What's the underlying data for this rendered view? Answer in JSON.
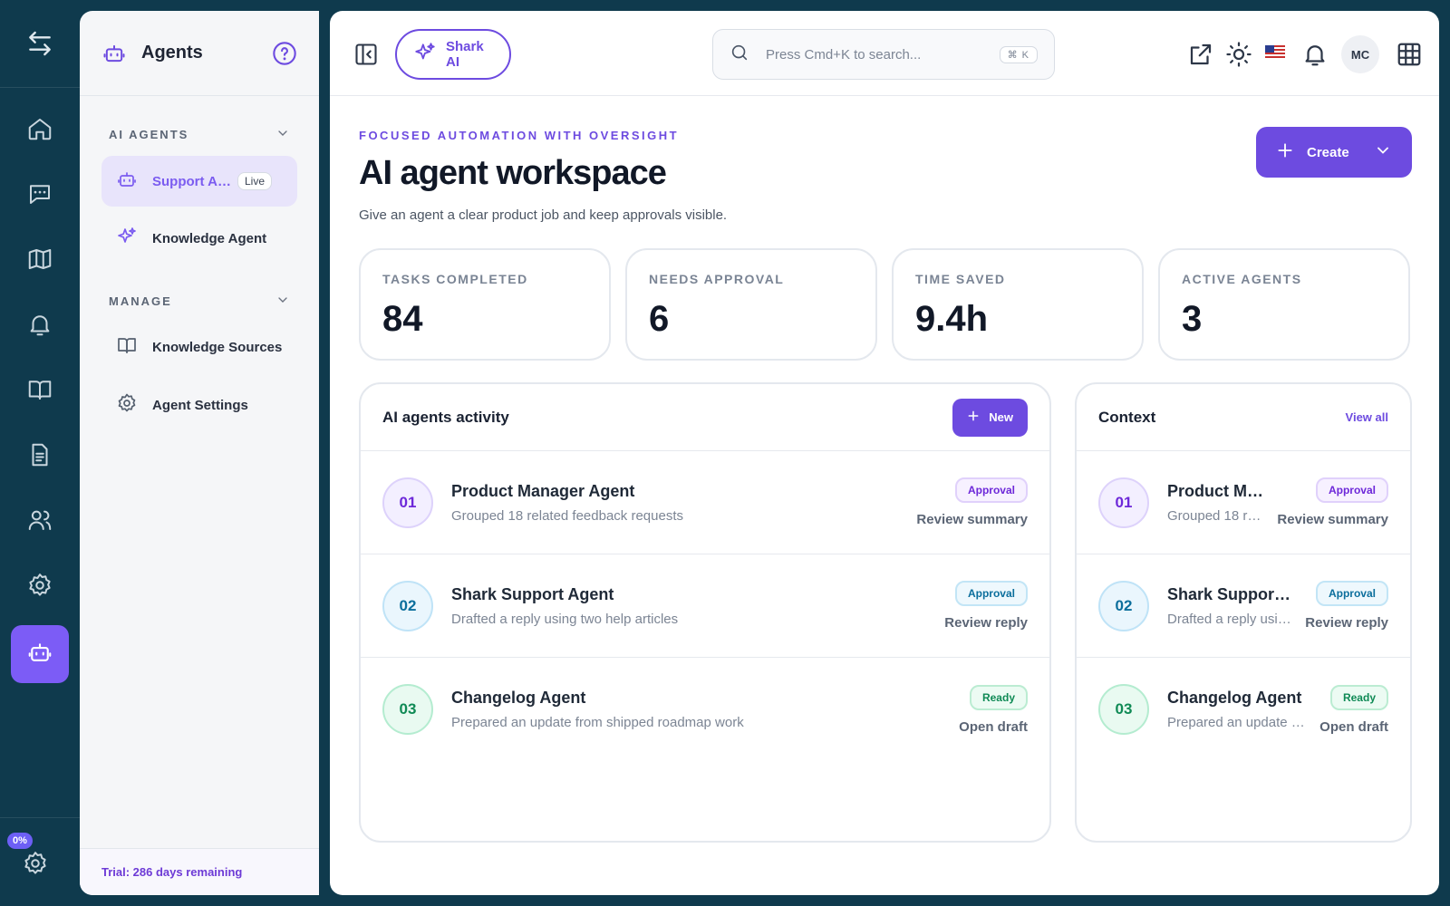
{
  "rail": {
    "items": [
      "swap-arrows-icon",
      "home-icon",
      "chat-icon",
      "map-icon",
      "bell-icon",
      "book-icon",
      "document-icon",
      "users-icon",
      "gear-icon",
      "robot-icon"
    ],
    "badge": "0%"
  },
  "sidebar": {
    "title": "Agents",
    "section_ai": "AI AGENTS",
    "section_manage": "MANAGE",
    "items": [
      {
        "label": "Support Agent",
        "pill": "Live"
      },
      {
        "label": "Knowledge Agent"
      },
      {
        "label": "Knowledge Sources"
      },
      {
        "label": "Agent Settings"
      }
    ],
    "footer": "Trial: 286 days remaining"
  },
  "topbar": {
    "shark_label": "Shark AI",
    "search_placeholder": "Press Cmd+K to search...",
    "shortcut": "⌘ K",
    "avatar": "MC"
  },
  "header": {
    "eyebrow": "FOCUSED AUTOMATION WITH OVERSIGHT",
    "title": "AI agent workspace",
    "subtitle": "Give an agent a clear product job and keep approvals visible.",
    "create_label": "Create"
  },
  "stats": [
    {
      "label": "TASKS COMPLETED",
      "value": "84"
    },
    {
      "label": "NEEDS APPROVAL",
      "value": "6"
    },
    {
      "label": "TIME SAVED",
      "value": "9.4h"
    },
    {
      "label": "ACTIVE AGENTS",
      "value": "3"
    }
  ],
  "activity": {
    "title": "AI agents activity",
    "new_label": "New",
    "rows": [
      {
        "num": "01",
        "title": "Product Manager Agent",
        "desc": "Grouped 18 related feedback requests",
        "pill": "Approval",
        "action": "Review summary"
      },
      {
        "num": "02",
        "title": "Shark Support Agent",
        "desc": "Drafted a reply using two help articles",
        "pill": "Approval",
        "action": "Review reply"
      },
      {
        "num": "03",
        "title": "Changelog Agent",
        "desc": "Prepared an update from shipped roadmap work",
        "pill": "Ready",
        "action": "Open draft"
      }
    ]
  },
  "context": {
    "title": "Context",
    "view_all": "View all"
  },
  "colors": {
    "accent": "#6d4be0",
    "rail_bg": "#0f3a4d",
    "active_rail": "#7c5cf6"
  }
}
